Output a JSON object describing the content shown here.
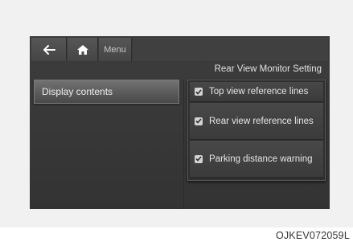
{
  "topbar": {
    "back_icon": "arrow-left-icon",
    "home_icon": "home-icon",
    "menu_label": "Menu"
  },
  "section_title": "Rear View Monitor Setting",
  "left_menu": {
    "items": [
      {
        "label": "Display contents"
      }
    ]
  },
  "options": [
    {
      "label": "Top view reference lines",
      "checked": true
    },
    {
      "label": "Rear view reference lines",
      "checked": true
    },
    {
      "label": "Parking distance warning",
      "checked": true
    }
  ],
  "caption": "OJKEV072059L"
}
